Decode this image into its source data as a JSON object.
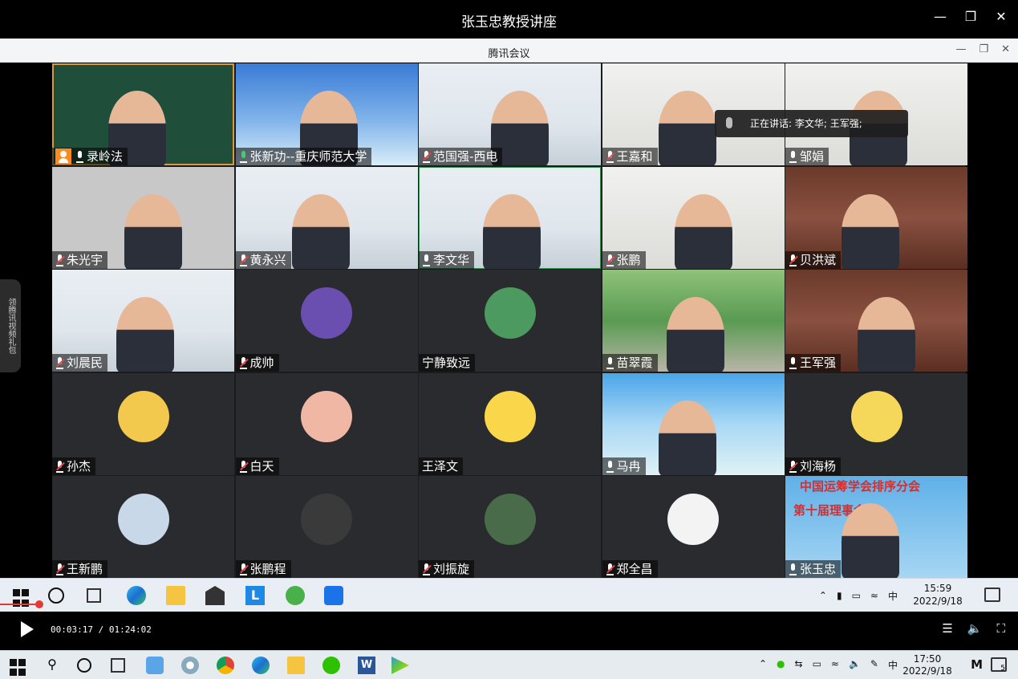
{
  "player": {
    "title": "张玉忠教授讲座",
    "time_display": "00:03:17 / 01:24:02",
    "progress_fraction": 0.039
  },
  "app": {
    "title": "腾讯会议",
    "speaking_text": "正在讲话: 李文华; 王军强;",
    "side_tab": "领腾讯视频礼包"
  },
  "participants": [
    {
      "name": "录岭法",
      "mic": "on",
      "host": true,
      "bg": "board"
    },
    {
      "name": "张新功--重庆师范大学",
      "mic": "green",
      "bg": "sky"
    },
    {
      "name": "范国强-西电",
      "mic": "muted",
      "bg": "room"
    },
    {
      "name": "王嘉和",
      "mic": "muted",
      "bg": "hall"
    },
    {
      "name": "邹娟",
      "mic": "on",
      "bg": "hall"
    },
    {
      "name": "朱光宇",
      "mic": "muted",
      "bg": "gray"
    },
    {
      "name": "黄永兴",
      "mic": "muted",
      "bg": "room"
    },
    {
      "name": "李文华",
      "mic": "on",
      "bg": "room"
    },
    {
      "name": "张鹏",
      "mic": "muted",
      "bg": "hall"
    },
    {
      "name": "贝洪斌",
      "mic": "muted",
      "bg": "books"
    },
    {
      "name": "刘晨民",
      "mic": "muted",
      "bg": "room"
    },
    {
      "name": "成帅",
      "mic": "muted",
      "bg": "avatar"
    },
    {
      "name": "宁静致远",
      "mic": "none",
      "bg": "avatar"
    },
    {
      "name": "苗翠霞",
      "mic": "on",
      "bg": "park"
    },
    {
      "name": "王军强",
      "mic": "on",
      "bg": "books"
    },
    {
      "name": "孙杰",
      "mic": "muted",
      "bg": "avatar"
    },
    {
      "name": "白天",
      "mic": "muted",
      "bg": "avatar"
    },
    {
      "name": "王泽文",
      "mic": "none",
      "bg": "avatar"
    },
    {
      "name": "马冉",
      "mic": "on",
      "bg": "beach"
    },
    {
      "name": "刘海杨",
      "mic": "muted",
      "bg": "avatar"
    },
    {
      "name": "王新鹏",
      "mic": "muted",
      "bg": "avatar"
    },
    {
      "name": "张鹏程",
      "mic": "muted",
      "bg": "avatar"
    },
    {
      "name": "刘振旋",
      "mic": "muted",
      "bg": "avatar"
    },
    {
      "name": "郑全昌",
      "mic": "muted",
      "bg": "avatar"
    },
    {
      "name": "张玉忠",
      "mic": "on",
      "bg": "banner"
    }
  ],
  "banner": {
    "line1": "中国运筹学会排序分会",
    "line2": "第十届理事会第"
  },
  "inner_taskbar": {
    "ime": "中",
    "time": "15:59",
    "date": "2022/9/18"
  },
  "os_taskbar": {
    "ime": "中",
    "time": "17:50",
    "date": "2022/9/18",
    "notification_count": "5"
  },
  "colors": {
    "host_badge": "#ff8a1f",
    "muted": "#e34848",
    "active_border": "#d89a3c",
    "progress": "#e53935"
  }
}
